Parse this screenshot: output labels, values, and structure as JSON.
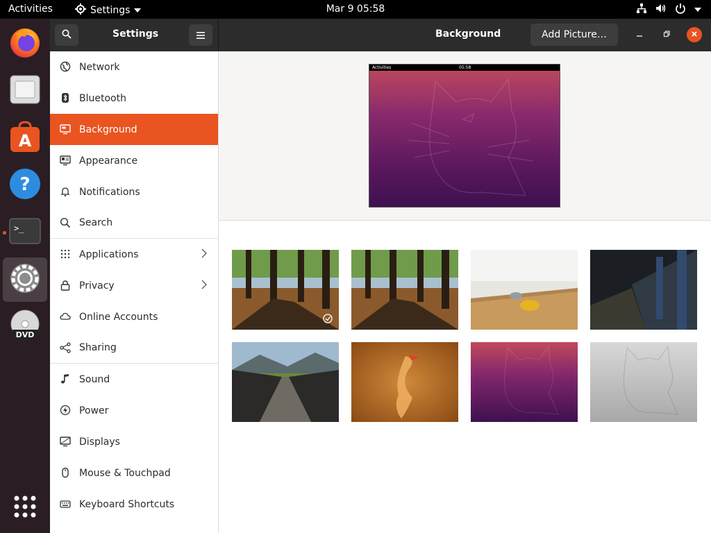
{
  "topbar": {
    "activities": "Activities",
    "app_name": "Settings",
    "clock": "Mar 9  05:58"
  },
  "dock": {
    "items": [
      {
        "name": "firefox-icon"
      },
      {
        "name": "files-icon"
      },
      {
        "name": "software-icon"
      },
      {
        "name": "help-icon"
      },
      {
        "name": "terminal-icon"
      },
      {
        "name": "settings-icon"
      },
      {
        "name": "dvd-icon"
      },
      {
        "name": "app-grid-icon"
      }
    ],
    "dvd_label": "DVD"
  },
  "headerbar": {
    "settings_title": "Settings",
    "page_title": "Background",
    "add_picture": "Add Picture…"
  },
  "sidebar": {
    "items": [
      {
        "label": "Network",
        "icon": "network-icon"
      },
      {
        "label": "Bluetooth",
        "icon": "bluetooth-icon"
      },
      {
        "label": "Background",
        "icon": "background-icon",
        "selected": true
      },
      {
        "label": "Appearance",
        "icon": "appearance-icon"
      },
      {
        "label": "Notifications",
        "icon": "notifications-icon"
      },
      {
        "label": "Search",
        "icon": "search-icon"
      },
      {
        "label": "Applications",
        "icon": "applications-icon",
        "chevron": true
      },
      {
        "label": "Privacy",
        "icon": "privacy-icon",
        "chevron": true
      },
      {
        "label": "Online Accounts",
        "icon": "cloud-icon"
      },
      {
        "label": "Sharing",
        "icon": "sharing-icon"
      },
      {
        "label": "Sound",
        "icon": "sound-icon"
      },
      {
        "label": "Power",
        "icon": "power-icon"
      },
      {
        "label": "Displays",
        "icon": "displays-icon"
      },
      {
        "label": "Mouse & Touchpad",
        "icon": "mouse-icon"
      },
      {
        "label": "Keyboard Shortcuts",
        "icon": "keyboard-icon"
      }
    ]
  },
  "preview": {
    "activities": "Activities",
    "clock": "05:58"
  },
  "wallpapers": [
    {
      "name": "forest-wallpaper",
      "selected": true
    },
    {
      "name": "forest-wallpaper-2"
    },
    {
      "name": "shuffleboard-wallpaper"
    },
    {
      "name": "subway-wallpaper"
    },
    {
      "name": "bridge-wallpaper"
    },
    {
      "name": "orange-bird-wallpaper"
    },
    {
      "name": "purple-cat-wallpaper"
    },
    {
      "name": "grey-cat-wallpaper"
    }
  ],
  "colors": {
    "accent": "#e95420",
    "header": "#2c2c2c",
    "dock": "#2a1e24"
  }
}
